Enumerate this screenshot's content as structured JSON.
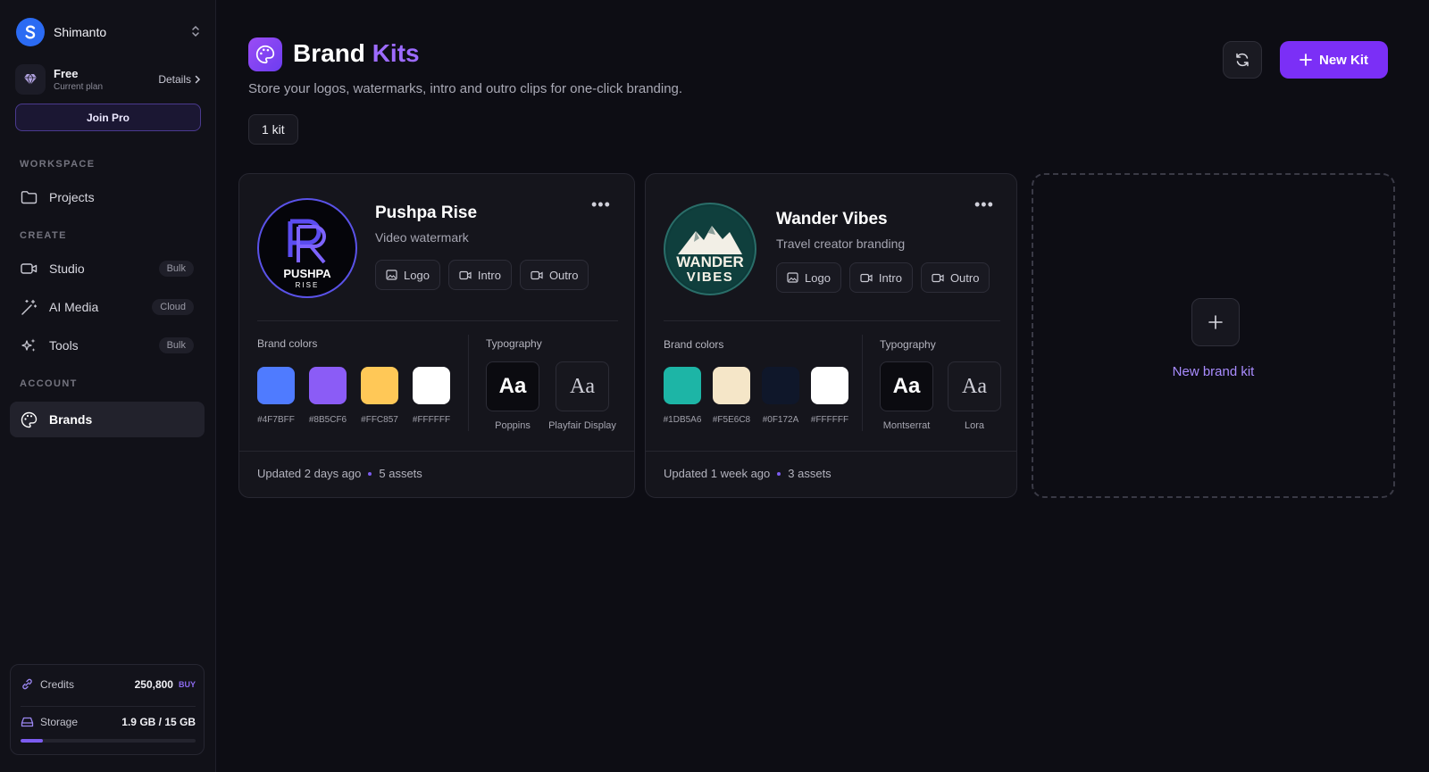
{
  "workspace": {
    "name": "Shimanto",
    "logo_icon": "s-logo-icon"
  },
  "plan": {
    "name": "Free",
    "subtitle": "Current plan",
    "details_label": "Details"
  },
  "join_pro_label": "Join Pro",
  "sidebar": {
    "sections": {
      "workspace": "WORKSPACE",
      "create": "CREATE",
      "account": "ACCOUNT"
    },
    "items": [
      {
        "label": "Projects",
        "icon": "folder-icon"
      },
      {
        "label": "Studio",
        "icon": "video-icon",
        "badge": "Bulk"
      },
      {
        "label": "AI Media",
        "icon": "magic-wand-icon",
        "badge": "Cloud"
      },
      {
        "label": "Tools",
        "icon": "sparkles-icon",
        "badge": "Bulk"
      },
      {
        "label": "Brands",
        "icon": "palette-icon",
        "active": true
      }
    ]
  },
  "usage": {
    "credits_label": "Credits",
    "credits_value": "250,800",
    "buy_label": "BUY",
    "storage_label": "Storage",
    "storage_value": "1.9 GB / 15 GB",
    "storage_fraction": 0.127
  },
  "header": {
    "title_main": "Brand",
    "title_accent": "Kits",
    "subtitle": "Store your logos, watermarks, intro and outro clips for one-click branding.",
    "kit_count": "1 kit",
    "new_kit_label": "New Kit"
  },
  "kits": [
    {
      "name": "Pushpa Rise",
      "description": "Video watermark",
      "logo_text_main": "PUSHPA",
      "logo_text_sub": "RISE",
      "chips": [
        "Logo",
        "Intro",
        "Outro"
      ],
      "colors_label": "Brand colors",
      "colors": [
        {
          "hex": "#4F7BFF",
          "label": "#4F7BFF"
        },
        {
          "hex": "#8B5CF6",
          "label": "#8B5CF6"
        },
        {
          "hex": "#FFC857",
          "label": "#FFC857"
        },
        {
          "hex": "#FFFFFF",
          "label": "#FFFFFF"
        }
      ],
      "typography_label": "Typography",
      "fonts": [
        {
          "sample": "Aa",
          "name": "Poppins"
        },
        {
          "sample": "Aa",
          "name": "Playfair Display"
        }
      ],
      "updated": "Updated 2 days ago",
      "assets": "5 assets"
    },
    {
      "name": "Wander Vibes",
      "description": "Travel creator branding",
      "logo_text_main": "WANDER",
      "logo_text_sub": "VIBES",
      "chips": [
        "Logo",
        "Intro",
        "Outro"
      ],
      "colors_label": "Brand colors",
      "colors": [
        {
          "hex": "#1DB5A6",
          "label": "#1DB5A6"
        },
        {
          "hex": "#F5E6C8",
          "label": "#F5E6C8"
        },
        {
          "hex": "#0F172A",
          "label": "#0F172A"
        },
        {
          "hex": "#FFFFFF",
          "label": "#FFFFFF"
        }
      ],
      "typography_label": "Typography",
      "fonts": [
        {
          "sample": "Aa",
          "name": "Montserrat"
        },
        {
          "sample": "Aa",
          "name": "Lora"
        }
      ],
      "updated": "Updated 1 week ago",
      "assets": "3 assets"
    }
  ],
  "new_brand_kit_label": "New brand kit",
  "theme": {
    "accent": "#7b2ff6",
    "accent_text": "#9d6bff",
    "background": "#0d0d14"
  }
}
